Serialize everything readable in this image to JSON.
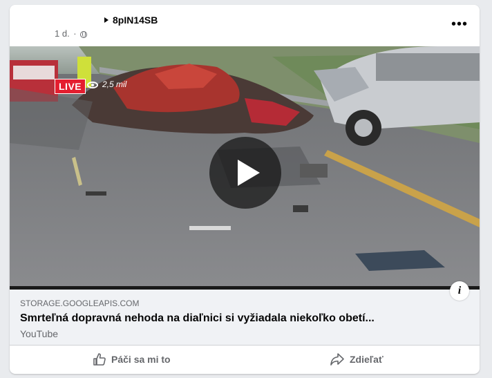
{
  "post": {
    "author": "8pIN14SB",
    "time": "1 d.",
    "more_icon": "more-horizontal-icon",
    "privacy_icon": "globe-icon"
  },
  "video": {
    "live_label": "LIVE",
    "views": "2,5 mil",
    "play_icon": "play-icon",
    "info_label": "i"
  },
  "link_preview": {
    "domain": "STORAGE.GOOGLEAPIS.COM",
    "title": "Smrteľná dopravná nehoda na diaľnici si vyžiadala niekoľko obetí...",
    "source": "YouTube"
  },
  "actions": {
    "like_label": "Páči sa mi to",
    "share_label": "Zdieľať",
    "like_icon": "thumbs-up-icon",
    "share_icon": "share-arrow-icon"
  }
}
